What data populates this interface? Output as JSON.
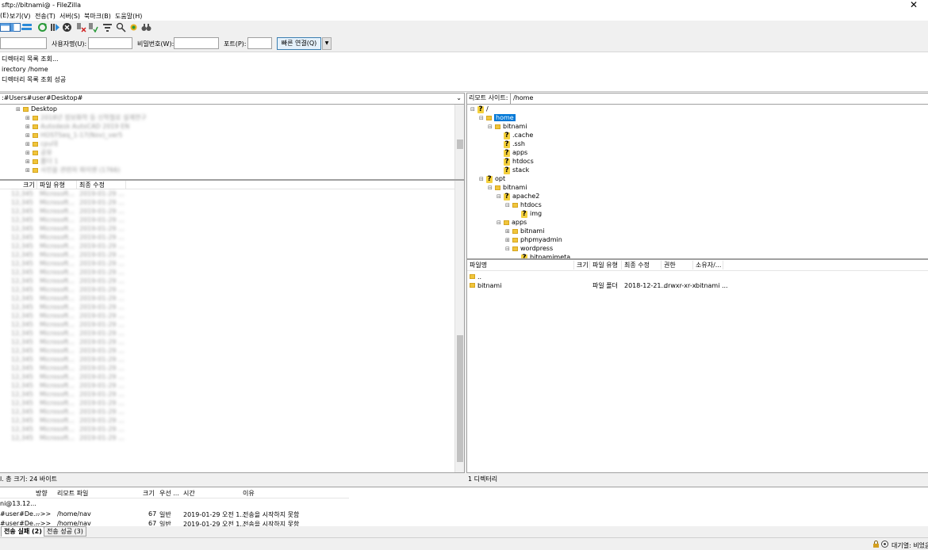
{
  "window": {
    "title": "sftp://bitnami@ - FileZilla",
    "close": "✕"
  },
  "menu": [
    "보기(V)",
    "전송(T)",
    "서버(S)",
    "북마크(B)",
    "도움말(H)"
  ],
  "menu_partial": "(E)",
  "quickconnect": {
    "username_label": "사용자명(U):",
    "password_label": "비밀번호(W):",
    "port_label": "포트(P):",
    "connect_button": "빠른 연결(Q)",
    "dropdown": "▼"
  },
  "log": [
    "디렉터리 목록 조회...",
    "irectory /home",
    "디렉터리 목록 조회 성공"
  ],
  "local": {
    "path": ":#Users#user#Desktop#",
    "tree": [
      {
        "label": "Desktop",
        "depth": 1,
        "blur": false
      },
      {
        "label": "2018년 정보화학 등 신학철로 설계연구",
        "depth": 2,
        "blur": true
      },
      {
        "label": "Autodesk AutoCAD 2019 EN",
        "depth": 2,
        "blur": true
      },
      {
        "label": "HOSTSeq_1-17(Nov)_ver5",
        "depth": 2,
        "blur": true
      },
      {
        "label": "cpu대",
        "depth": 2,
        "blur": true
      },
      {
        "label": "공유",
        "depth": 2,
        "blur": true
      },
      {
        "label": "폴더 1",
        "depth": 2,
        "blur": true
      },
      {
        "label": "사진을 관련자 파이엔 (1766)",
        "depth": 2,
        "blur": true
      }
    ],
    "columns": [
      "크기",
      "파일 유형",
      "최종 수정"
    ],
    "status": "l. 총 크기: 24 바이트",
    "row_count": 29
  },
  "remote": {
    "path_label": "리모트 사이트:",
    "path": "/home",
    "tree": [
      {
        "label": "/",
        "depth": 0,
        "icon": "q",
        "exp": "⊟"
      },
      {
        "label": "home",
        "depth": 1,
        "icon": "folder",
        "exp": "⊟",
        "selected": true
      },
      {
        "label": "bitnami",
        "depth": 2,
        "icon": "folder",
        "exp": "⊟"
      },
      {
        "label": ".cache",
        "depth": 3,
        "icon": "q",
        "exp": ""
      },
      {
        "label": ".ssh",
        "depth": 3,
        "icon": "q",
        "exp": ""
      },
      {
        "label": "apps",
        "depth": 3,
        "icon": "q",
        "exp": ""
      },
      {
        "label": "htdocs",
        "depth": 3,
        "icon": "q",
        "exp": ""
      },
      {
        "label": "stack",
        "depth": 3,
        "icon": "q",
        "exp": ""
      },
      {
        "label": "opt",
        "depth": 1,
        "icon": "q",
        "exp": "⊟"
      },
      {
        "label": "bitnami",
        "depth": 2,
        "icon": "folder",
        "exp": "⊟"
      },
      {
        "label": "apache2",
        "depth": 3,
        "icon": "q",
        "exp": "⊟"
      },
      {
        "label": "htdocs",
        "depth": 4,
        "icon": "folder",
        "exp": "⊟"
      },
      {
        "label": "img",
        "depth": 5,
        "icon": "q",
        "exp": ""
      },
      {
        "label": "apps",
        "depth": 3,
        "icon": "folder",
        "exp": "⊟"
      },
      {
        "label": "bitnami",
        "depth": 4,
        "icon": "folder",
        "exp": "⊞"
      },
      {
        "label": "phpmyadmin",
        "depth": 4,
        "icon": "folder",
        "exp": "⊞"
      },
      {
        "label": "wordpress",
        "depth": 4,
        "icon": "folder",
        "exp": "⊟"
      },
      {
        "label": "bitnamimeta",
        "depth": 5,
        "icon": "q",
        "exp": ""
      }
    ],
    "columns": [
      "파일명",
      "크기",
      "파일 유형",
      "최종 수정",
      "권한",
      "소유자/..."
    ],
    "files": [
      {
        "name": "..",
        "size": "",
        "type": "",
        "modified": "",
        "perm": "",
        "owner": ""
      },
      {
        "name": "bitnami",
        "size": "",
        "type": "파일 폴더",
        "modified": "2018-12-21...",
        "perm": "drwxr-xr-x",
        "owner": "bitnami ..."
      }
    ],
    "status": "1 디렉터리"
  },
  "queue": {
    "columns": [
      "방향",
      "리모트 파일",
      "크기",
      "우선 ...",
      "시간",
      "이유"
    ],
    "server": "ni@13.12...",
    "rows": [
      {
        "local": "#user#De...",
        "dir": "-->>",
        "remote": "/home/nav",
        "size": "67",
        "prio": "일반",
        "time": "2019-01-29 오전 1...",
        "reason": "전송을 시작하지 못함"
      },
      {
        "local": "#user#De...",
        "dir": "-->>",
        "remote": "/home/nav",
        "size": "67",
        "prio": "일반",
        "time": "2019-01-29 오전 1...",
        "reason": "전송을 시작하지 못함"
      }
    ]
  },
  "tabs": [
    {
      "label": "전송 실패 (2)",
      "active": true
    },
    {
      "label": "전송 성공 (3)",
      "active": false
    }
  ],
  "statusbar": {
    "queue_label": "대기열: 비었음"
  }
}
